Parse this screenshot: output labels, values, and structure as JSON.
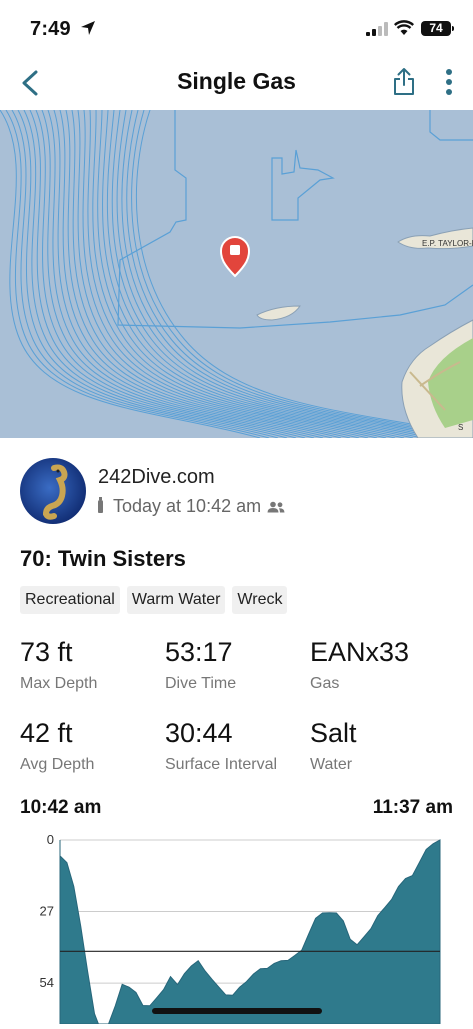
{
  "status_bar": {
    "time": "7:49",
    "battery": "74"
  },
  "nav": {
    "title": "Single Gas"
  },
  "map": {
    "label": "E.P. TAYLOR-D",
    "corner_label": "S"
  },
  "dive": {
    "site": "242Dive.com",
    "date": "Today at 10:42 am",
    "title": "70: Twin Sisters",
    "tags": [
      "Recreational",
      "Warm Water",
      "Wreck"
    ]
  },
  "stats": [
    {
      "value": "73 ft",
      "label": "Max Depth"
    },
    {
      "value": "53:17",
      "label": "Dive Time"
    },
    {
      "value": "EANx33",
      "label": "Gas"
    },
    {
      "value": "42 ft",
      "label": "Avg Depth"
    },
    {
      "value": "30:44",
      "label": "Surface Interval"
    },
    {
      "value": "Salt",
      "label": "Water"
    }
  ],
  "profile": {
    "start_time": "10:42 am",
    "end_time": "11:37 am",
    "y_ticks": [
      "0",
      "27",
      "54"
    ]
  },
  "colors": {
    "accent": "#2e6f85",
    "chart_fill": "#2f7a8c",
    "pin": "#e2453c",
    "map_water": "#a9bfd6",
    "map_contour": "#5aa0d6"
  },
  "chart_data": {
    "type": "area",
    "x_start": "10:42 am",
    "x_end": "11:37 am",
    "ylim": [
      0,
      73
    ],
    "y_ticks": [
      0,
      27,
      54
    ],
    "reference_line_y": 42,
    "inverted_y": true,
    "x_minutes": [
      0,
      1,
      2,
      3,
      4,
      5,
      6,
      7,
      8,
      9,
      10,
      11,
      12,
      13,
      14,
      15,
      16,
      17,
      18,
      19,
      20,
      21,
      22,
      23,
      24,
      25,
      26,
      27,
      28,
      29,
      30,
      31,
      32,
      33,
      34,
      35,
      36,
      37,
      38,
      39,
      40,
      41,
      42,
      43,
      44,
      45,
      46,
      47,
      48,
      49,
      50,
      51,
      52,
      53,
      54,
      55
    ],
    "depth_ft": [
      6,
      9,
      18,
      32,
      50,
      66,
      72,
      70,
      63,
      54,
      56,
      58,
      62,
      63,
      60,
      56,
      52,
      55,
      50,
      48,
      46,
      49,
      53,
      56,
      58,
      59,
      56,
      53,
      51,
      49,
      48,
      47,
      46,
      45,
      44,
      42,
      35,
      30,
      28,
      27,
      28,
      31,
      37,
      40,
      37,
      33,
      29,
      26,
      22,
      18,
      15,
      13,
      9,
      4,
      1,
      0
    ]
  }
}
